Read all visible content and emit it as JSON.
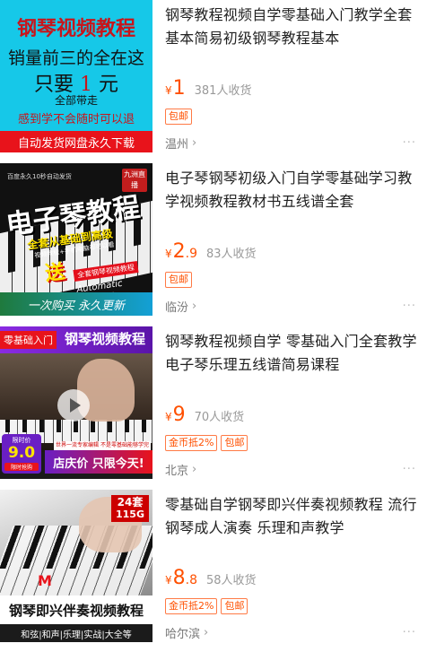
{
  "items": [
    {
      "title": "钢琴教程视频自学零基础入门教学全套基本简易初级钢琴教程基本",
      "price": {
        "currency": "¥",
        "integer": "1",
        "decimal": ""
      },
      "sales": "381人收货",
      "tags": [
        "包邮"
      ],
      "location": "温州",
      "thumb": {
        "heading": "钢琴视频教程",
        "line1": "销量前三的全在这",
        "line2_pre": "只要",
        "line2_num": "1",
        "line2_post": "元",
        "line3": "全部带走",
        "line4": "感到学不会随时可以退",
        "bar": "自动发货网盘永久下载"
      }
    },
    {
      "title": "电子琴钢琴初级入门自学零基础学习教学视频教程教材书五线谱全套",
      "price": {
        "currency": "¥",
        "integer": "2",
        "decimal": ".9"
      },
      "sales": "83人收货",
      "tags": [
        "包邮"
      ],
      "location": "临汾",
      "thumb": {
        "top": "百度永久10秒自动发货",
        "corner": "九洲直播",
        "big": "电子琴教程",
        "sub": "全套从基础到高级",
        "sub2": "视频教程+手机电脑都可以看",
        "send": "送",
        "redband": "全套钢琴视频教程",
        "auto": "Automatic delivery",
        "bottom": "一次购买  永久更新"
      }
    },
    {
      "title": "钢琴教程视频自学 零基础入门全套教学电子琴乐理五线谱简易课程",
      "price": {
        "currency": "¥",
        "integer": "9",
        "decimal": ""
      },
      "sales": "70人收货",
      "tags": [
        "金币抵2%",
        "包邮"
      ],
      "location": "北京",
      "thumb": {
        "label": "零基础入门",
        "title": "钢琴视频教程",
        "badge_a": "限时价",
        "badge_b": "9.0",
        "badge_c": "限时抢购",
        "tiny": "世界一流专家编辑 不是零基础能够学完",
        "strip": "店庆价 只限今天!"
      }
    },
    {
      "title": "零基础自学钢琴即兴伴奏视频教程 流行钢琴成人演奏 乐理和声教学",
      "price": {
        "currency": "¥",
        "integer": "8",
        "decimal": ".8"
      },
      "sales": "58人收货",
      "tags": [
        "金币抵2%",
        "包邮"
      ],
      "location": "哈尔滨",
      "thumb": {
        "badge_a": "24套",
        "badge_b": "115G",
        "logo": "M",
        "title": "钢琴即兴伴奏视频教程",
        "sub": "和弦|和声|乐理|实战|大全等"
      }
    }
  ],
  "ui": {
    "chevron": "›",
    "more": "···"
  }
}
